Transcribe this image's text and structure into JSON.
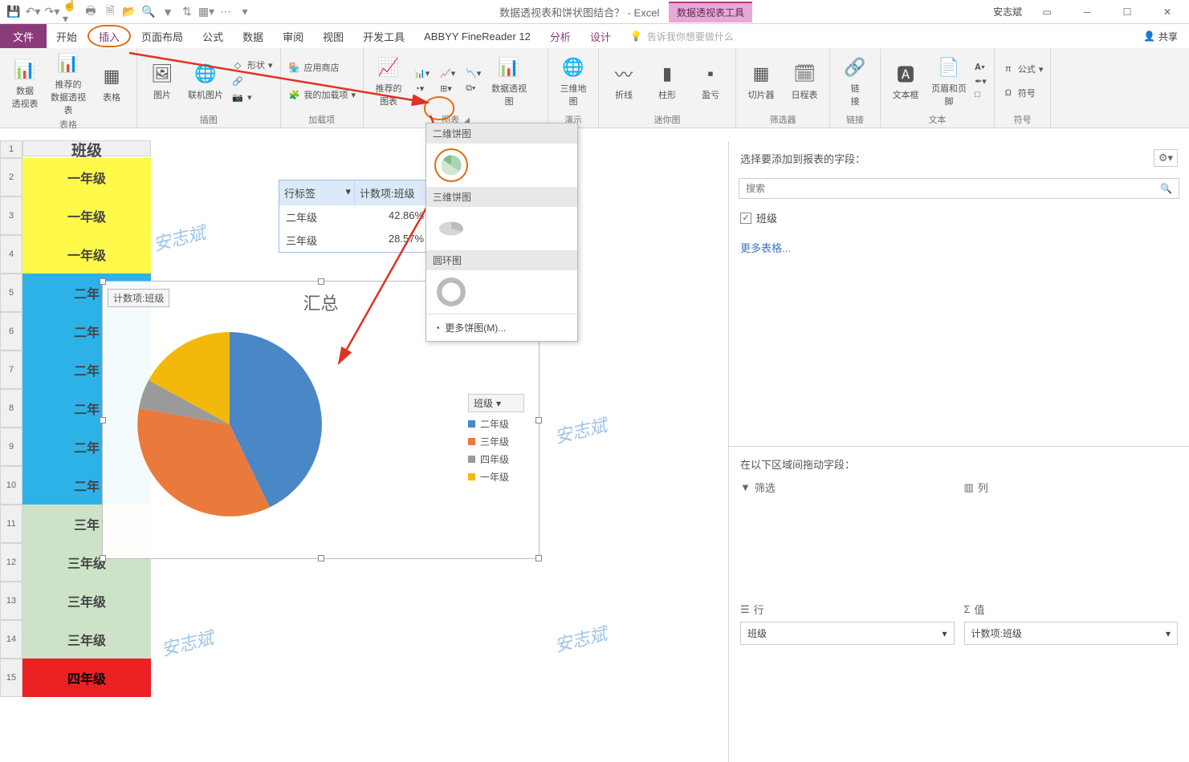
{
  "titlebar": {
    "doc": "数据透视表和饼状图结合？",
    "app": " - Excel",
    "context_tool": "数据透视表工具",
    "user": "安志斌"
  },
  "tabs": {
    "file": "文件",
    "home": "开始",
    "insert": "插入",
    "layout": "页面布局",
    "formula": "公式",
    "data": "数据",
    "review": "审阅",
    "view": "视图",
    "dev": "开发工具",
    "abbyy": "ABBYY FineReader 12",
    "analyze": "分析",
    "design": "设计",
    "tellme": "告诉我你想要做什么",
    "share": "共享"
  },
  "ribbon": {
    "tables": {
      "label": "表格",
      "pivot": "数据\n透视表",
      "recpivot": "推荐的\n数据透视表",
      "table": "表格"
    },
    "illus": {
      "label": "插图",
      "picture": "图片",
      "online": "联机图片",
      "shapes": "形状"
    },
    "addins": {
      "label": "加载项",
      "store": "应用商店",
      "my": "我的加载项"
    },
    "charts": {
      "label": "图表",
      "rec": "推荐的\n图表",
      "pivotchart": "数据透视图"
    },
    "tour": {
      "label": "演示",
      "map3d": "三维地\n图"
    },
    "spark": {
      "label": "迷你图",
      "line": "折线",
      "col": "柱形",
      "winloss": "盈亏"
    },
    "filter": {
      "label": "筛选器",
      "slicer": "切片器",
      "timeline": "日程表"
    },
    "links": {
      "label": "链接",
      "link": "链\n接"
    },
    "text": {
      "label": "文本",
      "textbox": "文本框",
      "header": "页眉和页脚"
    },
    "symbols": {
      "label": "符号",
      "eq": "公式",
      "sym": "符号"
    }
  },
  "pie_gallery": {
    "sec1": "二维饼图",
    "sec2": "三维饼图",
    "sec3": "圆环图",
    "more": "更多饼图(M)..."
  },
  "sheet": {
    "header": "班级",
    "rows": [
      "一年级",
      "一年级",
      "一年级",
      "二年",
      "二年",
      "二年",
      "二年",
      "二年",
      "二年",
      "三年",
      "三年级",
      "三年级",
      "三年级",
      "四年级"
    ]
  },
  "pivot": {
    "row_label": "行标签",
    "val_label": "计数项:班级",
    "r1": {
      "k": "二年级",
      "v": "42.86%"
    },
    "r2": {
      "k": "三年级",
      "v": "28.57%"
    }
  },
  "chart": {
    "tag": "计数项:班级",
    "title": "汇总",
    "legend_title": "班级",
    "legend": [
      "二年级",
      "三年级",
      "四年级",
      "一年级"
    ]
  },
  "chart_data": {
    "type": "pie",
    "title": "汇总",
    "series": [
      {
        "name": "计数项:班级",
        "categories": [
          "二年级",
          "三年级",
          "四年级",
          "一年级"
        ],
        "values": [
          42.86,
          28.57,
          7.14,
          21.43
        ]
      }
    ],
    "colors": [
      "#4a87c6",
      "#ea7a3b",
      "#9a9a9a",
      "#f2b90c"
    ]
  },
  "fieldpane": {
    "title": "选择要添加到报表的字段：",
    "search": "搜索",
    "field1": "班级",
    "more": "更多表格...",
    "areas_label": "在以下区域间拖动字段：",
    "filters": "筛选",
    "cols": "列",
    "rows": "行",
    "values": "值",
    "row_val": "班级",
    "val_val": "计数项:班级"
  },
  "watermarks": {
    "w1": "安志斌",
    "w2": "安志斌",
    "w3": "安志斌",
    "w4": "安志斌"
  }
}
